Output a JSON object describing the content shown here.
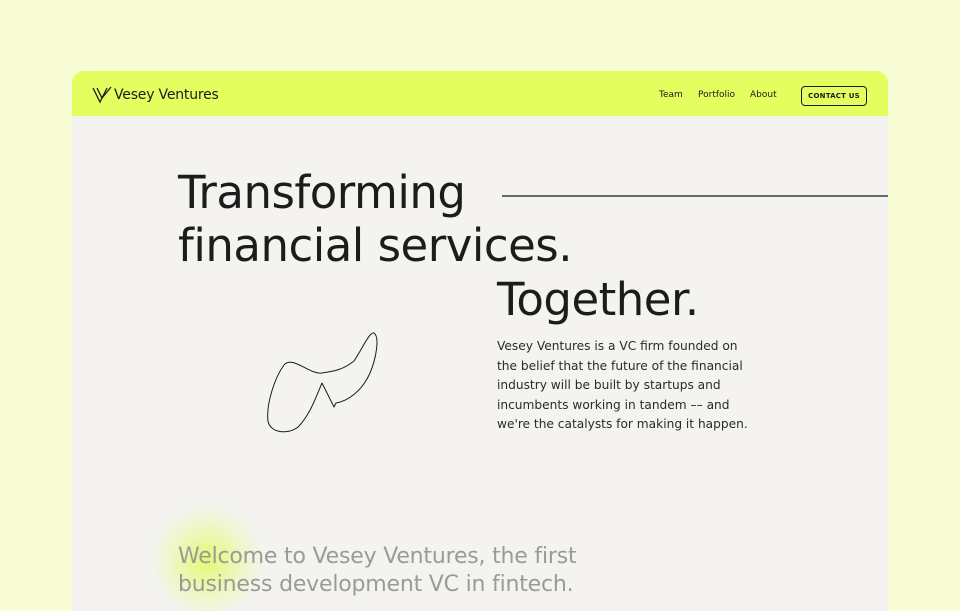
{
  "brand": {
    "name": "Vesey Ventures",
    "logo_icon": "v-monogram-icon"
  },
  "nav": {
    "links": [
      "Team",
      "Portfolio",
      "About"
    ],
    "cta_label": "CONTACT US"
  },
  "hero": {
    "line1": "Transforming",
    "line2": "financial services.",
    "line3": "Together.",
    "description": "Vesey Ventures is a VC firm founded on the belief that the future of the financial industry will be built by startups and incumbents working in tandem –– and we're the catalysts for making it happen.",
    "illustration": "squiggle-line-icon"
  },
  "welcome": {
    "text": "Welcome to Vesey Ventures, the first business development VC in fintech."
  },
  "colors": {
    "page_bg": "#f8fdd5",
    "nav_bg": "#e4fd5f",
    "content_bg": "#f4f3ef",
    "text": "#1c1c1c",
    "muted_text": "#9a9a96"
  }
}
